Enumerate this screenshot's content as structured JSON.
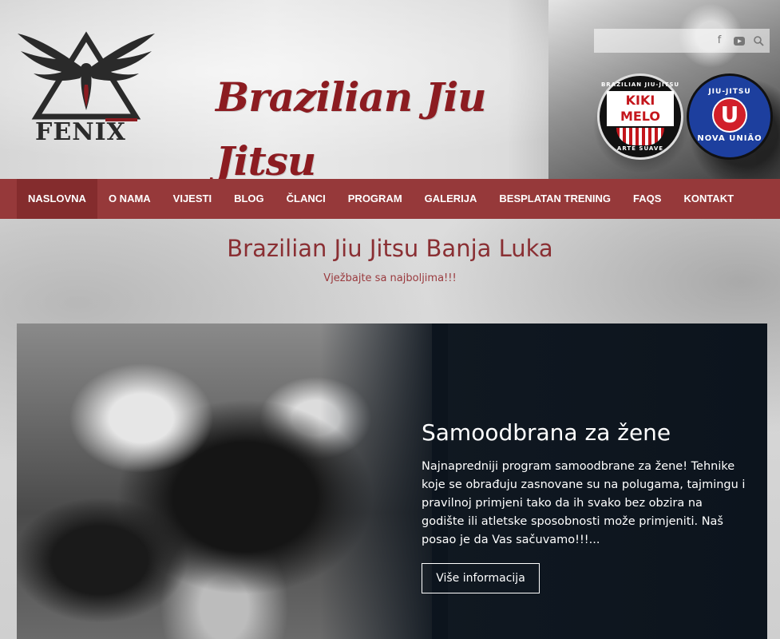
{
  "header": {
    "logo_text": "FENIX",
    "script_title": "Brazilian Jiu Jitsu",
    "social": {
      "icons": [
        "facebook-icon",
        "youtube-icon",
        "search-icon"
      ]
    },
    "badge_kiki": {
      "top": "BRAZILIAN JIU-JITSU",
      "name": "KIKI MELO",
      "bottom": "ARTE SUAVE"
    },
    "badge_nova": {
      "top": "JIU-JITSU",
      "letter": "U",
      "bottom": "NOVA UNIÃO"
    }
  },
  "nav": {
    "items": [
      {
        "label": "NASLOVNA",
        "active": true
      },
      {
        "label": "O NAMA"
      },
      {
        "label": "VIJESTI"
      },
      {
        "label": "BLOG"
      },
      {
        "label": "ČLANCI"
      },
      {
        "label": "PROGRAM"
      },
      {
        "label": "GALERIJA"
      },
      {
        "label": "BESPLATAN TRENING"
      },
      {
        "label": "FAQS"
      },
      {
        "label": "KONTAKT"
      }
    ],
    "colors": {
      "bar": "#96393a",
      "active": "#842c2d"
    }
  },
  "hero": {
    "title": "Brazilian Jiu Jitsu Banja Luka",
    "subtitle": "Vježbajte sa najboljima!!!"
  },
  "slide": {
    "title": "Samoodbrana za žene",
    "text": "Najnapredniji program samoodbrane za žene! Tehnike koje se obrađuju zasnovane su na polugama, tajmingu i pravilnoj primjeni tako da ih svako bez obzira na godište ili atletske sposobnosti može primjeniti.  Naš posao je da Vas sačuvamo!!!...",
    "button_label": "Više informacija"
  }
}
